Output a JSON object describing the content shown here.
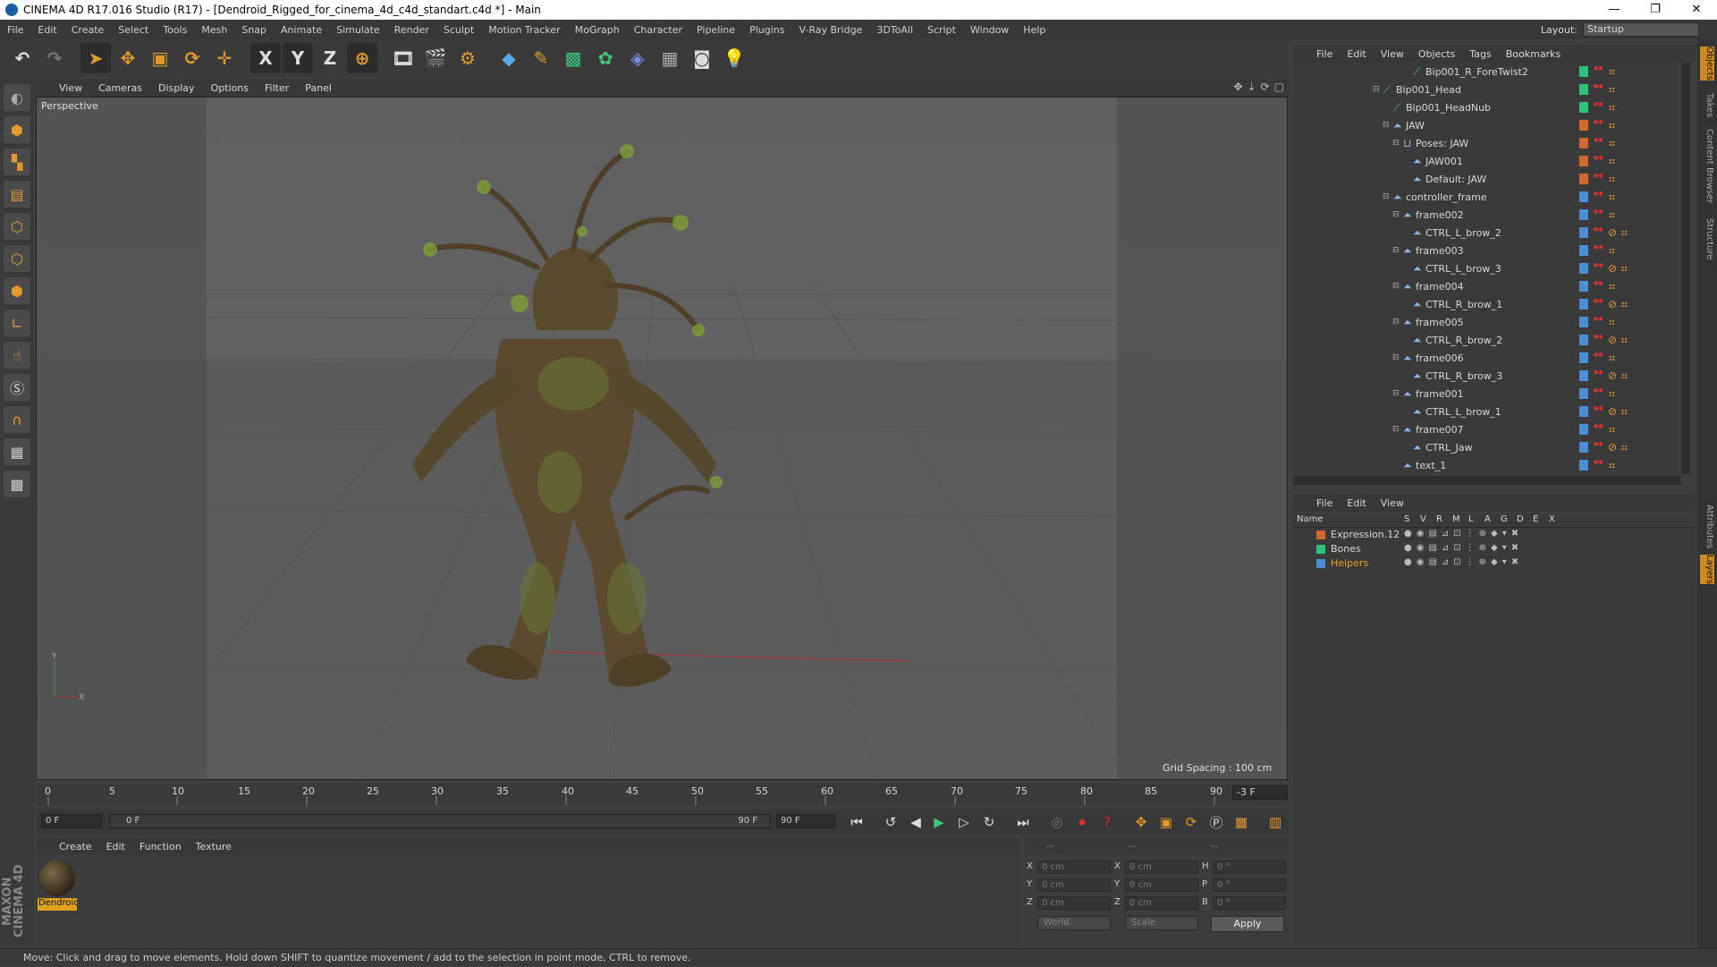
{
  "window": {
    "title": "CINEMA 4D R17.016 Studio (R17) - [Dendroid_Rigged_for_cinema_4d_c4d_standart.c4d *] - Main",
    "controls": [
      "—",
      "❐",
      "✕"
    ]
  },
  "menubar": {
    "items": [
      "File",
      "Edit",
      "Create",
      "Select",
      "Tools",
      "Mesh",
      "Snap",
      "Animate",
      "Simulate",
      "Render",
      "Sculpt",
      "Motion Tracker",
      "MoGraph",
      "Character",
      "Pipeline",
      "Plugins",
      "V-Ray Bridge",
      "3DToAll",
      "Script",
      "Window",
      "Help"
    ],
    "layout_label": "Layout:",
    "layout_value": "Startup"
  },
  "toolbar": {
    "axis_x": "X",
    "axis_y": "Y",
    "axis_z": "Z",
    "icons": [
      "undo-icon",
      "redo-icon",
      "select-arrow-icon",
      "move-icon",
      "scale-icon",
      "rotate-icon",
      "live-selection-icon",
      "x-axis-icon",
      "y-axis-icon",
      "z-axis-icon",
      "coordinate-system-icon",
      "render-view-icon",
      "render-picture-icon",
      "edit-render-settings-icon",
      "cube-icon",
      "pen-icon",
      "subdivision-icon",
      "cloner-icon",
      "deformer-icon",
      "floor-icon",
      "camera-icon",
      "light-icon"
    ]
  },
  "viewport": {
    "menu": [
      "View",
      "Cameras",
      "Display",
      "Options",
      "Filter",
      "Panel"
    ],
    "label": "Perspective",
    "grid_spacing": "Grid Spacing : 100 cm",
    "axis_y": "Y",
    "axis_x": "X"
  },
  "timeline": {
    "ticks": [
      "0",
      "5",
      "10",
      "15",
      "20",
      "25",
      "30",
      "35",
      "40",
      "45",
      "50",
      "55",
      "60",
      "65",
      "70",
      "75",
      "80",
      "85",
      "90"
    ],
    "current_frame": "-3 F",
    "start": "0 F",
    "range_start": "0 F",
    "range_end": "90 F",
    "end": "90 F"
  },
  "material_manager": {
    "menu": [
      "Create",
      "Edit",
      "Function",
      "Texture"
    ],
    "material_name": "Dendroid"
  },
  "coordinates": {
    "header": [
      "--",
      "--",
      "--"
    ],
    "rows": [
      {
        "pos_label": "X",
        "pos": "0 cm",
        "size_label": "X",
        "size": "0 cm",
        "rot_label": "H",
        "rot": "0 °"
      },
      {
        "pos_label": "Y",
        "pos": "0 cm",
        "size_label": "Y",
        "size": "0 cm",
        "rot_label": "P",
        "rot": "0 °"
      },
      {
        "pos_label": "Z",
        "pos": "0 cm",
        "size_label": "Z",
        "size": "0 cm",
        "rot_label": "B",
        "rot": "0 °"
      }
    ],
    "mode": "World",
    "size_mode": "Scale",
    "apply": "Apply"
  },
  "object_manager": {
    "menu": [
      "File",
      "Edit",
      "View",
      "Objects",
      "Tags",
      "Bookmarks"
    ],
    "rows": [
      {
        "name": "Bip001_R_ForeTwist2",
        "depth": 4,
        "color": "#2fc27a",
        "icon": "bone"
      },
      {
        "name": "Bip001_Head",
        "depth": 1,
        "color": "#2fc27a",
        "icon": "bone",
        "fold": true
      },
      {
        "name": "Bip001_HeadNub",
        "depth": 2,
        "color": "#2fc27a",
        "icon": "bone"
      },
      {
        "name": "JAW",
        "depth": 2,
        "color": "#d2692a",
        "icon": "null",
        "fold": true
      },
      {
        "name": "Poses: JAW",
        "depth": 3,
        "color": "#d2692a",
        "icon": "pose",
        "fold": true
      },
      {
        "name": "JAW001",
        "depth": 4,
        "color": "#d2692a",
        "icon": "null"
      },
      {
        "name": "Default: JAW",
        "depth": 4,
        "color": "#d2692a",
        "icon": "null"
      },
      {
        "name": "controller_frame",
        "depth": 2,
        "color": "#4a8fd6",
        "icon": "null",
        "fold": true
      },
      {
        "name": "frame002",
        "depth": 3,
        "color": "#4a8fd6",
        "icon": "null",
        "fold": true
      },
      {
        "name": "CTRL_L_brow_2",
        "depth": 4,
        "color": "#4a8fd6",
        "icon": "null",
        "blocked": true
      },
      {
        "name": "frame003",
        "depth": 3,
        "color": "#4a8fd6",
        "icon": "null",
        "fold": true
      },
      {
        "name": "CTRL_L_brow_3",
        "depth": 4,
        "color": "#4a8fd6",
        "icon": "null",
        "blocked": true
      },
      {
        "name": "frame004",
        "depth": 3,
        "color": "#4a8fd6",
        "icon": "null",
        "fold": true
      },
      {
        "name": "CTRL_R_brow_1",
        "depth": 4,
        "color": "#4a8fd6",
        "icon": "null",
        "blocked": true
      },
      {
        "name": "frame005",
        "depth": 3,
        "color": "#4a8fd6",
        "icon": "null",
        "fold": true
      },
      {
        "name": "CTRL_R_brow_2",
        "depth": 4,
        "color": "#4a8fd6",
        "icon": "null",
        "blocked": true
      },
      {
        "name": "frame006",
        "depth": 3,
        "color": "#4a8fd6",
        "icon": "null",
        "fold": true
      },
      {
        "name": "CTRL_R_brow_3",
        "depth": 4,
        "color": "#4a8fd6",
        "icon": "null",
        "blocked": true
      },
      {
        "name": "frame001",
        "depth": 3,
        "color": "#4a8fd6",
        "icon": "null",
        "fold": true
      },
      {
        "name": "CTRL_L_brow_1",
        "depth": 4,
        "color": "#4a8fd6",
        "icon": "null",
        "blocked": true
      },
      {
        "name": "frame007",
        "depth": 3,
        "color": "#4a8fd6",
        "icon": "null",
        "fold": true
      },
      {
        "name": "CTRL_Jaw",
        "depth": 4,
        "color": "#4a8fd6",
        "icon": "null",
        "blocked": true
      },
      {
        "name": "text_1",
        "depth": 3,
        "color": "#4a8fd6",
        "icon": "null"
      }
    ]
  },
  "layer_manager": {
    "menu": [
      "File",
      "Edit",
      "View"
    ],
    "columns": [
      "Name",
      "S",
      "V",
      "R",
      "M",
      "L",
      "A",
      "G",
      "D",
      "E",
      "X"
    ],
    "layers": [
      {
        "name": "Expression.12",
        "color": "#d2692a",
        "highlight": false
      },
      {
        "name": "Bones",
        "color": "#2fc27a",
        "highlight": false
      },
      {
        "name": "Helpers",
        "color": "#4a8fd6",
        "highlight": true
      }
    ]
  },
  "right_tabs": [
    "Objects",
    "Takes",
    "Content Browser",
    "Structure",
    "Attributes",
    "Layers"
  ],
  "brand": "MAXON CINEMA 4D",
  "status": "Move: Click and drag to move elements. Hold down SHIFT to quantize movement / add to the selection in point mode, CTRL to remove.",
  "colors": {
    "accent": "#e39a2c",
    "panel": "#3a3a3a",
    "highlight_text": "#e8a020"
  }
}
